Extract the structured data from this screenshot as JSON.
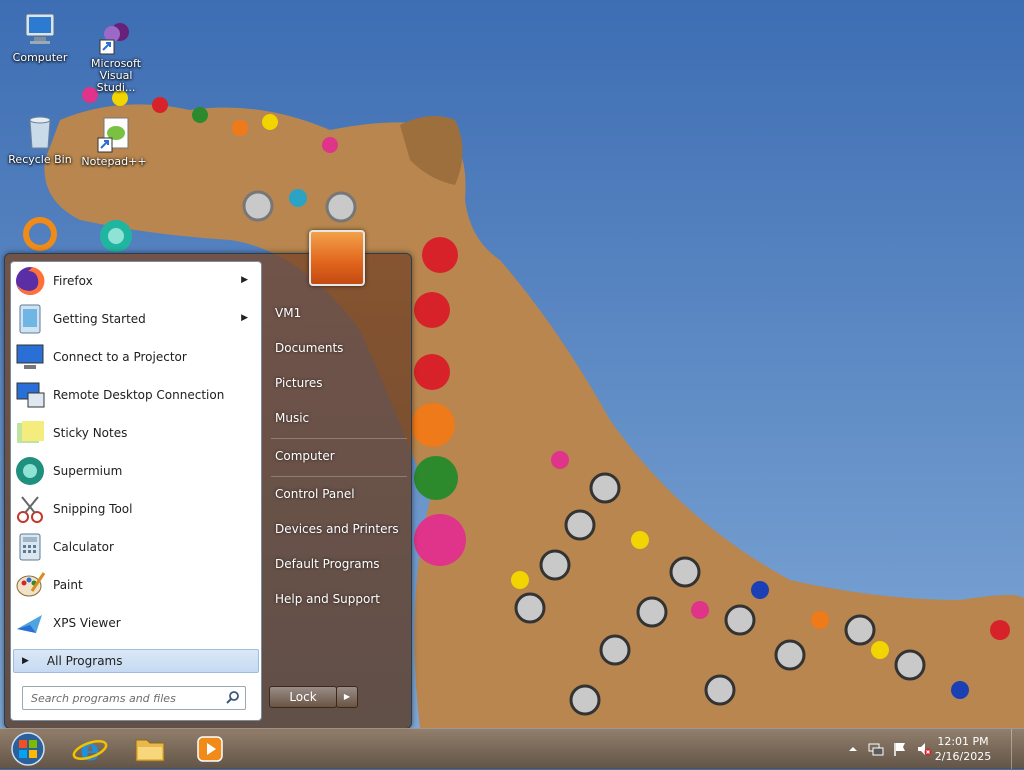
{
  "desktop": {
    "icons": [
      {
        "label": "Computer",
        "icon": "computer-icon"
      },
      {
        "label": "Microsoft Visual Studi...",
        "icon": "visual-studio-icon"
      },
      {
        "label": "Recycle Bin",
        "icon": "recycle-bin-icon"
      },
      {
        "label": "Notepad++",
        "icon": "notepad-plus-plus-icon"
      }
    ]
  },
  "start_menu": {
    "programs": [
      {
        "label": "Firefox",
        "icon": "firefox-icon",
        "submenu": true
      },
      {
        "label": "Getting Started",
        "icon": "getting-started-icon",
        "submenu": true
      },
      {
        "label": "Connect to a Projector",
        "icon": "projector-icon",
        "submenu": false
      },
      {
        "label": "Remote Desktop Connection",
        "icon": "remote-desktop-icon",
        "submenu": false
      },
      {
        "label": "Sticky Notes",
        "icon": "sticky-notes-icon",
        "submenu": false
      },
      {
        "label": "Supermium",
        "icon": "supermium-icon",
        "submenu": false
      },
      {
        "label": "Snipping Tool",
        "icon": "snipping-tool-icon",
        "submenu": false
      },
      {
        "label": "Calculator",
        "icon": "calculator-icon",
        "submenu": false
      },
      {
        "label": "Paint",
        "icon": "paint-icon",
        "submenu": false
      },
      {
        "label": "XPS Viewer",
        "icon": "xps-viewer-icon",
        "submenu": false
      }
    ],
    "all_programs": "All Programs",
    "search_placeholder": "Search programs and files",
    "right_items": [
      "VM1",
      "Documents",
      "Pictures",
      "Music",
      "Computer",
      "Control Panel",
      "Devices and Printers",
      "Default Programs",
      "Help and Support"
    ],
    "lock_label": "Lock"
  },
  "taskbar": {
    "pinned": [
      "start-orb-icon",
      "internet-explorer-icon",
      "file-explorer-icon",
      "media-player-icon"
    ],
    "clock": {
      "time": "12:01 PM",
      "date": "2/16/2025"
    }
  },
  "colors": {
    "accent": "#3f6fb4",
    "menu_frame": "#7a4e2e"
  }
}
